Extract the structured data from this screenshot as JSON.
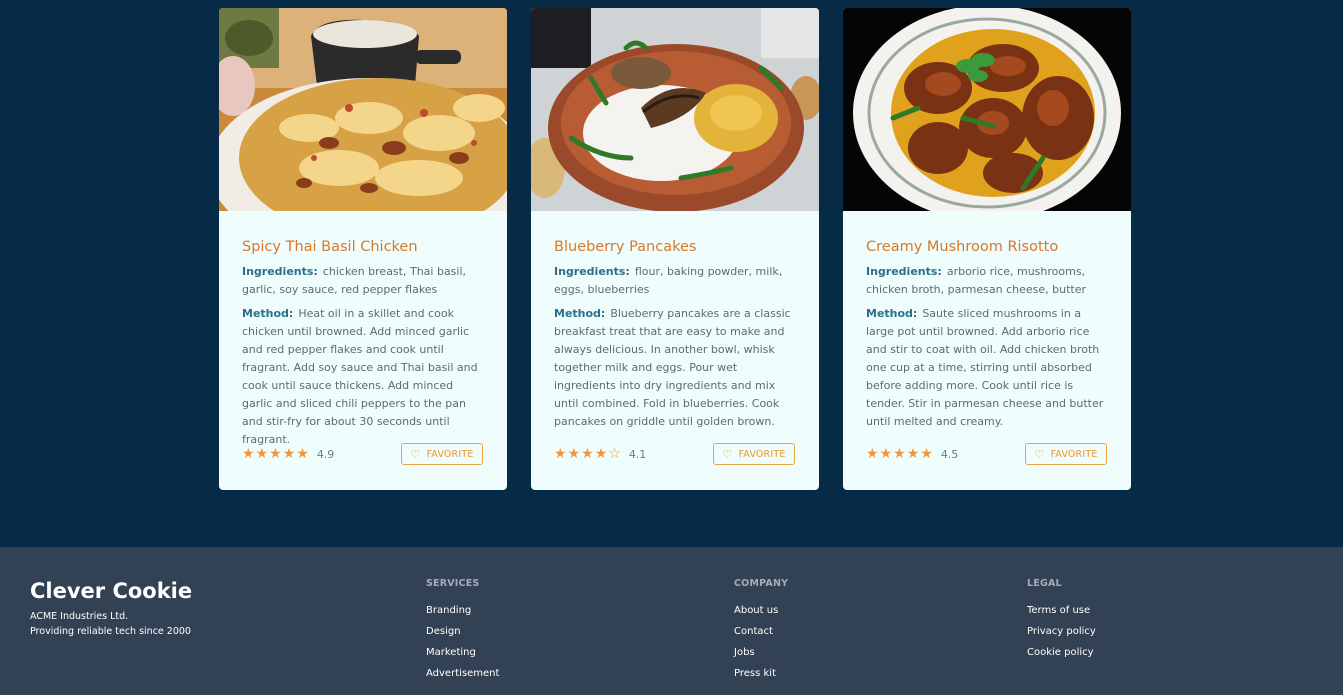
{
  "recipes": [
    {
      "title": "Spicy Thai Basil Chicken",
      "ingredients_label": "Ingredients:",
      "ingredients": "chicken breast, Thai basil, garlic, soy sauce, red pepper flakes",
      "method_label": "Method:",
      "method": "Heat oil in a skillet and cook chicken until browned. Add minced garlic and red pepper flakes and cook until fragrant. Add soy sauce and Thai basil and cook until sauce thickens. Add minced garlic and sliced chili peppers to the pan and stir-fry for about 30 seconds until fragrant.",
      "stars": 5,
      "rating": "4.9",
      "favorite_label": "FAVORITE",
      "image": "biryani rice dish with a cup of raita"
    },
    {
      "title": "Blueberry Pancakes",
      "ingredients_label": "Ingredients:",
      "ingredients": "flour, baking powder, milk, eggs, blueberries",
      "method_label": "Method:",
      "method": "Blueberry pancakes are a classic breakfast treat that are easy to make and always delicious. In another bowl, whisk together milk and eggs. Pour wet ingredients into dry ingredients and mix until combined. Fold in blueberries. Cook pancakes on griddle until golden brown.",
      "stars": 4,
      "rating": "4.1",
      "favorite_label": "FAVORITE",
      "image": "clay plate with rice, fried fish and chilies"
    },
    {
      "title": "Creamy Mushroom Risotto",
      "ingredients_label": "Ingredients:",
      "ingredients": "arborio rice, mushrooms, chicken broth, parmesan cheese, butter",
      "method_label": "Method:",
      "method": "Saute sliced mushrooms in a large pot until browned. Add arborio rice and stir to coat with oil. Add chicken broth one cup at a time, stirring until absorbed before adding more. Cook until rice is tender. Stir in parmesan cheese and butter until melted and creamy.",
      "stars": 5,
      "rating": "4.5",
      "favorite_label": "FAVORITE",
      "image": "fried fish curry on a white plate with mint"
    }
  ],
  "footer": {
    "brand": "Clever Cookie",
    "company_line": "ACME Industries Ltd.",
    "tagline": "Providing reliable tech since 2000",
    "services": {
      "title": "SERVICES",
      "links": [
        "Branding",
        "Design",
        "Marketing",
        "Advertisement"
      ]
    },
    "company": {
      "title": "COMPANY",
      "links": [
        "About us",
        "Contact",
        "Jobs",
        "Press kit"
      ]
    },
    "legal": {
      "title": "LEGAL",
      "links": [
        "Terms of use",
        "Privacy policy",
        "Cookie policy"
      ]
    }
  },
  "colors": {
    "page_bg": "#072a47",
    "card_bg": "#effdfd",
    "title": "#d9772a",
    "label": "#2b6f8c",
    "accent": "#e9a640",
    "footer_bg": "#334155"
  },
  "icons": {
    "star": "star-icon",
    "heart": "heart-icon"
  }
}
